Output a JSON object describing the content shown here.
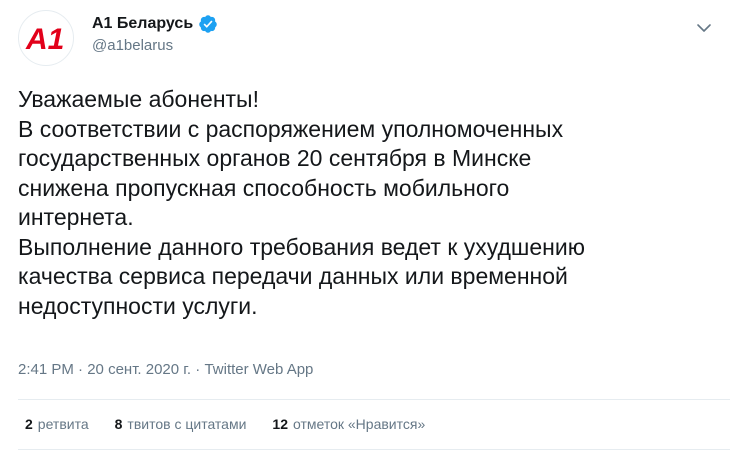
{
  "user": {
    "display_name": "А1 Беларусь",
    "handle": "@a1belarus",
    "logo_text": "A1",
    "verified_icon": "verified-badge-icon",
    "logo_color": "#e2001a",
    "verified_color": "#1da1f2"
  },
  "tweet": {
    "lines": [
      "Уважаемые абоненты!",
      "В соответствии с распоряжением уполномоченных",
      "государственных органов 20 сентября в Минске",
      "снижена пропускная способность мобильного",
      "интернета.",
      "Выполнение данного требования ведет к ухудшению",
      "качества сервиса передачи данных или временной",
      "недоступности услуги."
    ]
  },
  "meta": {
    "time": "2:41 PM",
    "separator": "·",
    "date": "20 сент. 2020 г.",
    "source": "Twitter Web App"
  },
  "stats": {
    "retweets_count": "2",
    "retweets_label": "ретвита",
    "quotes_count": "8",
    "quotes_label": "твитов с цитатами",
    "likes_count": "12",
    "likes_label": "отметок «Нравится»"
  },
  "icons": {
    "more": "chevron-down-icon"
  },
  "colors": {
    "text": "#14171a",
    "secondary": "#657786",
    "divider": "#e6ecf0"
  }
}
